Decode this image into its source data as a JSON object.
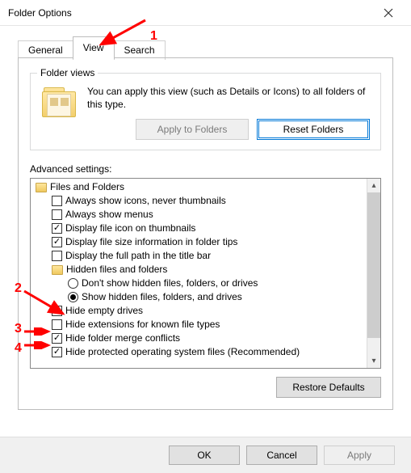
{
  "window": {
    "title": "Folder Options"
  },
  "tabs": {
    "general": "General",
    "view": "View",
    "search": "Search",
    "active": "view"
  },
  "folder_views": {
    "group_label": "Folder views",
    "description": "You can apply this view (such as Details or Icons) to all folders of this type.",
    "apply_btn": "Apply to Folders",
    "reset_btn": "Reset Folders"
  },
  "advanced": {
    "label": "Advanced settings:",
    "root": "Files and Folders",
    "items": [
      {
        "type": "checkbox",
        "checked": false,
        "label": "Always show icons, never thumbnails"
      },
      {
        "type": "checkbox",
        "checked": false,
        "label": "Always show menus"
      },
      {
        "type": "checkbox",
        "checked": true,
        "label": "Display file icon on thumbnails"
      },
      {
        "type": "checkbox",
        "checked": true,
        "label": "Display file size information in folder tips"
      },
      {
        "type": "checkbox",
        "checked": false,
        "label": "Display the full path in the title bar"
      },
      {
        "type": "folder",
        "label": "Hidden files and folders"
      },
      {
        "type": "radio",
        "checked": false,
        "label": "Don't show hidden files, folders, or drives",
        "level": 2
      },
      {
        "type": "radio",
        "checked": true,
        "label": "Show hidden files, folders, and drives",
        "level": 2
      },
      {
        "type": "checkbox",
        "checked": false,
        "label": "Hide empty drives"
      },
      {
        "type": "checkbox",
        "checked": false,
        "label": "Hide extensions for known file types"
      },
      {
        "type": "checkbox",
        "checked": true,
        "label": "Hide folder merge conflicts"
      },
      {
        "type": "checkbox",
        "checked": true,
        "label": "Hide protected operating system files (Recommended)"
      }
    ],
    "restore_btn": "Restore Defaults"
  },
  "buttons": {
    "ok": "OK",
    "cancel": "Cancel",
    "apply": "Apply"
  },
  "annotations": {
    "n1": "1",
    "n2": "2",
    "n3": "3",
    "n4": "4"
  }
}
